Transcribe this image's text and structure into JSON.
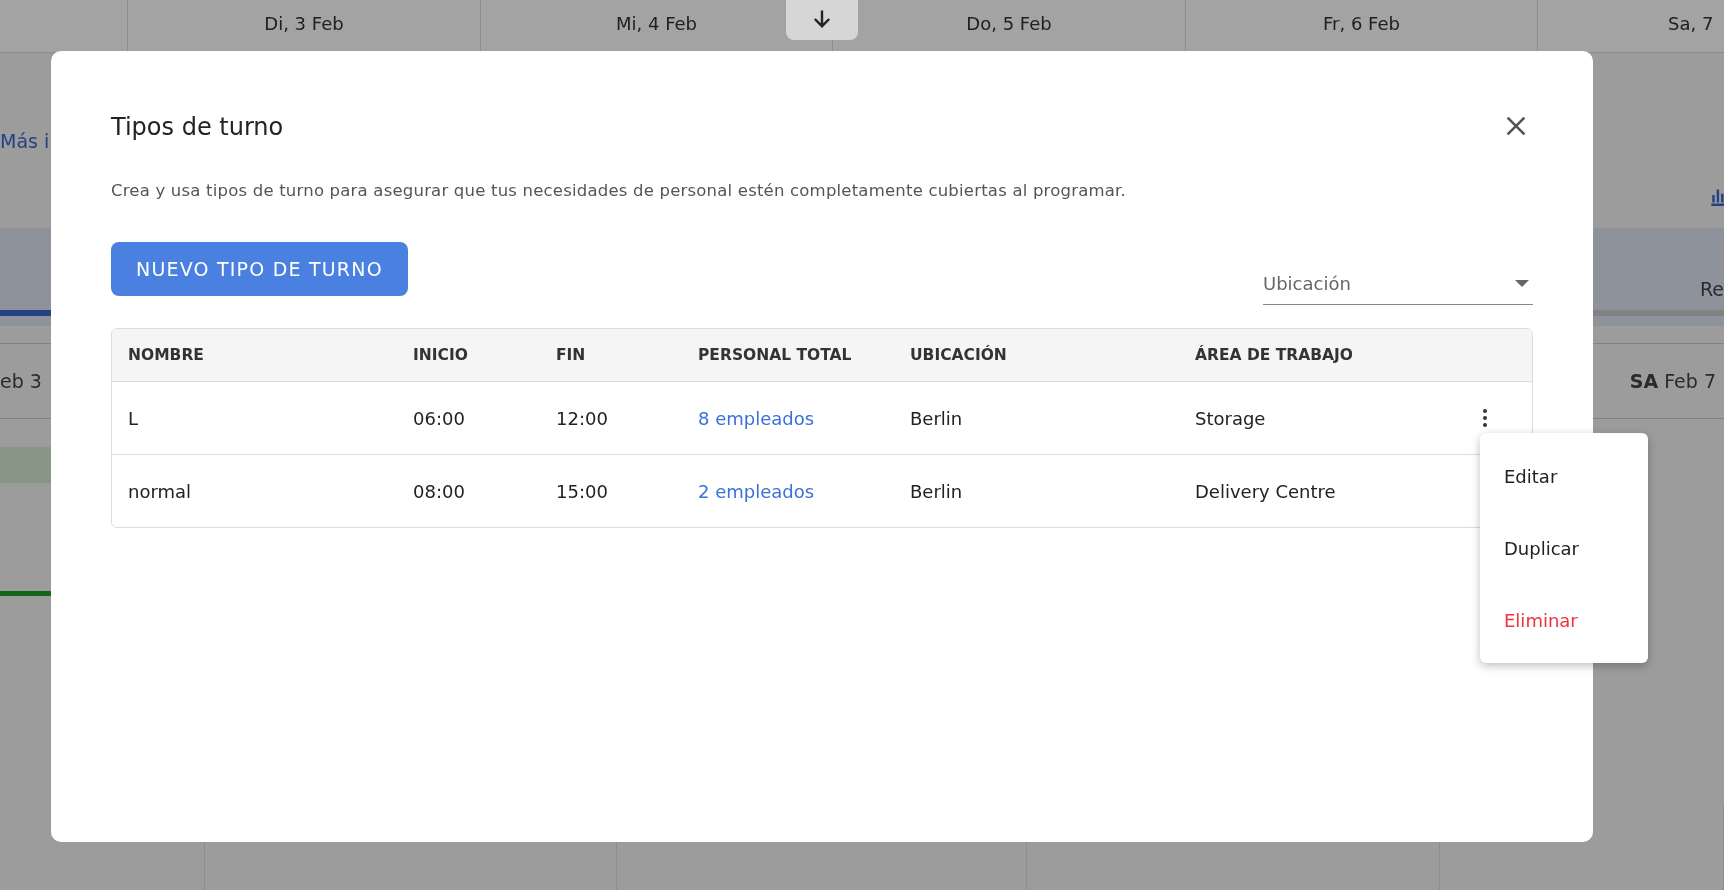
{
  "background": {
    "header_days": [
      "Di, 3 Feb",
      "Mi, 4 Feb",
      "Do, 5 Feb",
      "Fr, 6 Feb",
      "Sa, 7"
    ],
    "more_link": "Más i",
    "left_day": "eb 3",
    "right_day": {
      "weekday": "SA",
      "date": "Feb 7"
    },
    "right_label": "Re"
  },
  "dialog": {
    "title": "Tipos de turno",
    "description": "Crea y usa tipos de turno para asegurar que tus necesidades de personal estén completamente cubiertas al programar.",
    "new_button": "NUEVO TIPO DE TURNO",
    "location_filter": {
      "placeholder": "Ubicación"
    },
    "table": {
      "columns": [
        "NOMBRE",
        "INICIO",
        "FIN",
        "PERSONAL TOTAL",
        "UBICACIÓN",
        "ÁREA DE TRABAJO"
      ],
      "rows": [
        {
          "name": "L",
          "start": "06:00",
          "end": "12:00",
          "staff": "8 empleados",
          "location": "Berlin",
          "area": "Storage",
          "menu_icon": true
        },
        {
          "name": "normal",
          "start": "08:00",
          "end": "15:00",
          "staff": "2 empleados",
          "location": "Berlin",
          "area": "Delivery Centre",
          "menu_icon": false
        }
      ]
    }
  },
  "row_menu": {
    "items": [
      {
        "label": "Editar",
        "kind": "normal"
      },
      {
        "label": "Duplicar",
        "kind": "normal"
      },
      {
        "label": "Eliminar",
        "kind": "danger"
      }
    ]
  }
}
